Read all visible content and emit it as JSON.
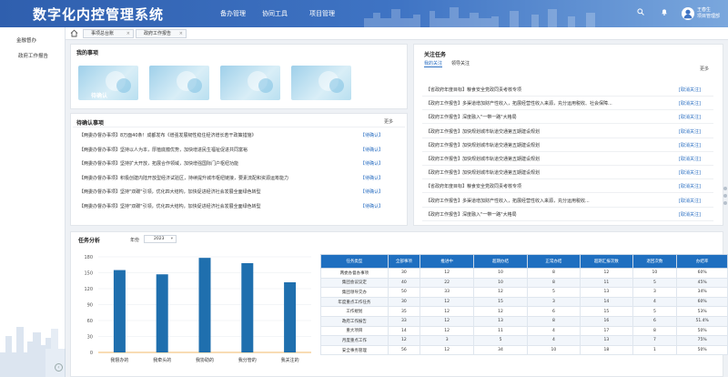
{
  "header": {
    "title": "数字化内控管理系统",
    "nav": [
      "备办管理",
      "协同工具",
      "项目管理"
    ],
    "user_name": "王春生",
    "user_dept": "项目管理部"
  },
  "sidebar": {
    "items": [
      "金融督办",
      "政府工作报告"
    ]
  },
  "tabs": [
    "事项总台账",
    "政府工作报告"
  ],
  "my_items": {
    "title": "我的事项",
    "cards": [
      "待确认",
      "",
      "",
      ""
    ]
  },
  "pending": {
    "title": "待确认事项",
    "more": "更多",
    "rows": [
      {
        "text": "【两委办督办事项】8万面40条！成都发布《增强发展韧性稳住经济增长若干政策措施》",
        "action": "【待确认】"
      },
      {
        "text": "【两委办督办事项】坚持以人为本，厚植底蕴优势，加快增进民生福祉促进共同富裕",
        "action": "【待确认】"
      },
      {
        "text": "【两委办督办事项】坚持扩大开放，拓展合作领域，加快增强国际门户枢纽功能",
        "action": "【待确认】"
      },
      {
        "text": "【两委办督办事项】积极创建内陆开放型经济试验区，持续提升城市枢纽链接，要素流配和资源运筹能力",
        "action": "【待确认】"
      },
      {
        "text": "【两委办督办事项】坚持\"双碳\"引领，优化四大结构，加快促进经济社会发展全面绿色转型",
        "action": "【待确认】"
      },
      {
        "text": "【两委办督办事项】坚持\"双碳\"引领，优化四大结构，加快促进经济社会发展全面绿色转型",
        "action": "【待确认】"
      }
    ]
  },
  "watch": {
    "title": "关注任务",
    "tab_mine": "我的关注",
    "tab_leader": "领导关注",
    "more": "更多",
    "rows": [
      {
        "text": "【省政府年度目标】粮食安全党政同责考核专项",
        "action": "[取消关注]"
      },
      {
        "text": "【政府工作报告】多渠道增加财产性收入，拓展经营性收入来源，充分运用税收、社会保障...",
        "action": "[取消关注]"
      },
      {
        "text": "【政府工作报告】深度融入\"一带一路\"大格局",
        "action": "[取消关注]"
      },
      {
        "text": "【政府工作报告】加快规划城市轨道交通第五期建设规划",
        "action": "[取消关注]"
      },
      {
        "text": "【政府工作报告】加快规划城市轨道交通第五期建设规划",
        "action": "[取消关注]"
      },
      {
        "text": "【政府工作报告】加快规划城市轨道交通第五期建设规划",
        "action": "[取消关注]"
      },
      {
        "text": "【政府工作报告】加快规划城市轨道交通第五期建设规划",
        "action": "[取消关注]"
      },
      {
        "text": "【省政府年度目标】粮食安全党政同责考核专项",
        "action": "[取消关注]"
      },
      {
        "text": "【政府工作报告】多渠道增加财产性收入，拓展经营性收入来源，充分运用税收...",
        "action": "[取消关注]"
      },
      {
        "text": "【政府工作报告】深度融入\"一带一路\"大格局",
        "action": "[取消关注]"
      }
    ]
  },
  "analysis": {
    "title": "任务分析",
    "year_label": "年份",
    "year_value": "2023",
    "table_headers": [
      "任务类型",
      "全部事项",
      "推进中",
      "超期办结",
      "正常办结",
      "超期汇报次数",
      "退回次数",
      "办结率"
    ],
    "table_rows": [
      [
        "两委办督办事项",
        "30",
        "12",
        "10",
        "8",
        "12",
        "10",
        "60%"
      ],
      [
        "集团会议议定",
        "40",
        "22",
        "10",
        "8",
        "11",
        "5",
        "45%"
      ],
      [
        "集团领导交办",
        "50",
        "33",
        "12",
        "5",
        "13",
        "3",
        "34%"
      ],
      [
        "年度重点工作任务",
        "30",
        "12",
        "15",
        "3",
        "14",
        "4",
        "60%"
      ],
      [
        "工作規划",
        "35",
        "12",
        "12",
        "6",
        "15",
        "5",
        "53%"
      ],
      [
        "政府工作报告",
        "33",
        "12",
        "13",
        "8",
        "16",
        "6",
        "51.4%"
      ],
      [
        "重大项目",
        "14",
        "12",
        "11",
        "4",
        "17",
        "8",
        "50%"
      ],
      [
        "月度重点工作",
        "12",
        "3",
        "5",
        "4",
        "13",
        "7",
        "75%"
      ],
      [
        "安全事务管理",
        "56",
        "12",
        "34",
        "10",
        "18",
        "1",
        "50%"
      ]
    ]
  },
  "chart_data": {
    "type": "bar",
    "categories": [
      "我督办的",
      "我牵头的",
      "我协助的",
      "我分管的",
      "我关注的"
    ],
    "values": [
      155,
      147,
      178,
      168,
      132
    ],
    "ylim": [
      0,
      180
    ],
    "yticks": [
      0,
      30,
      60,
      90,
      120,
      150,
      180
    ],
    "bar_color": "#1f6fae",
    "baseline_color": "#f0b86a",
    "grid": true
  }
}
